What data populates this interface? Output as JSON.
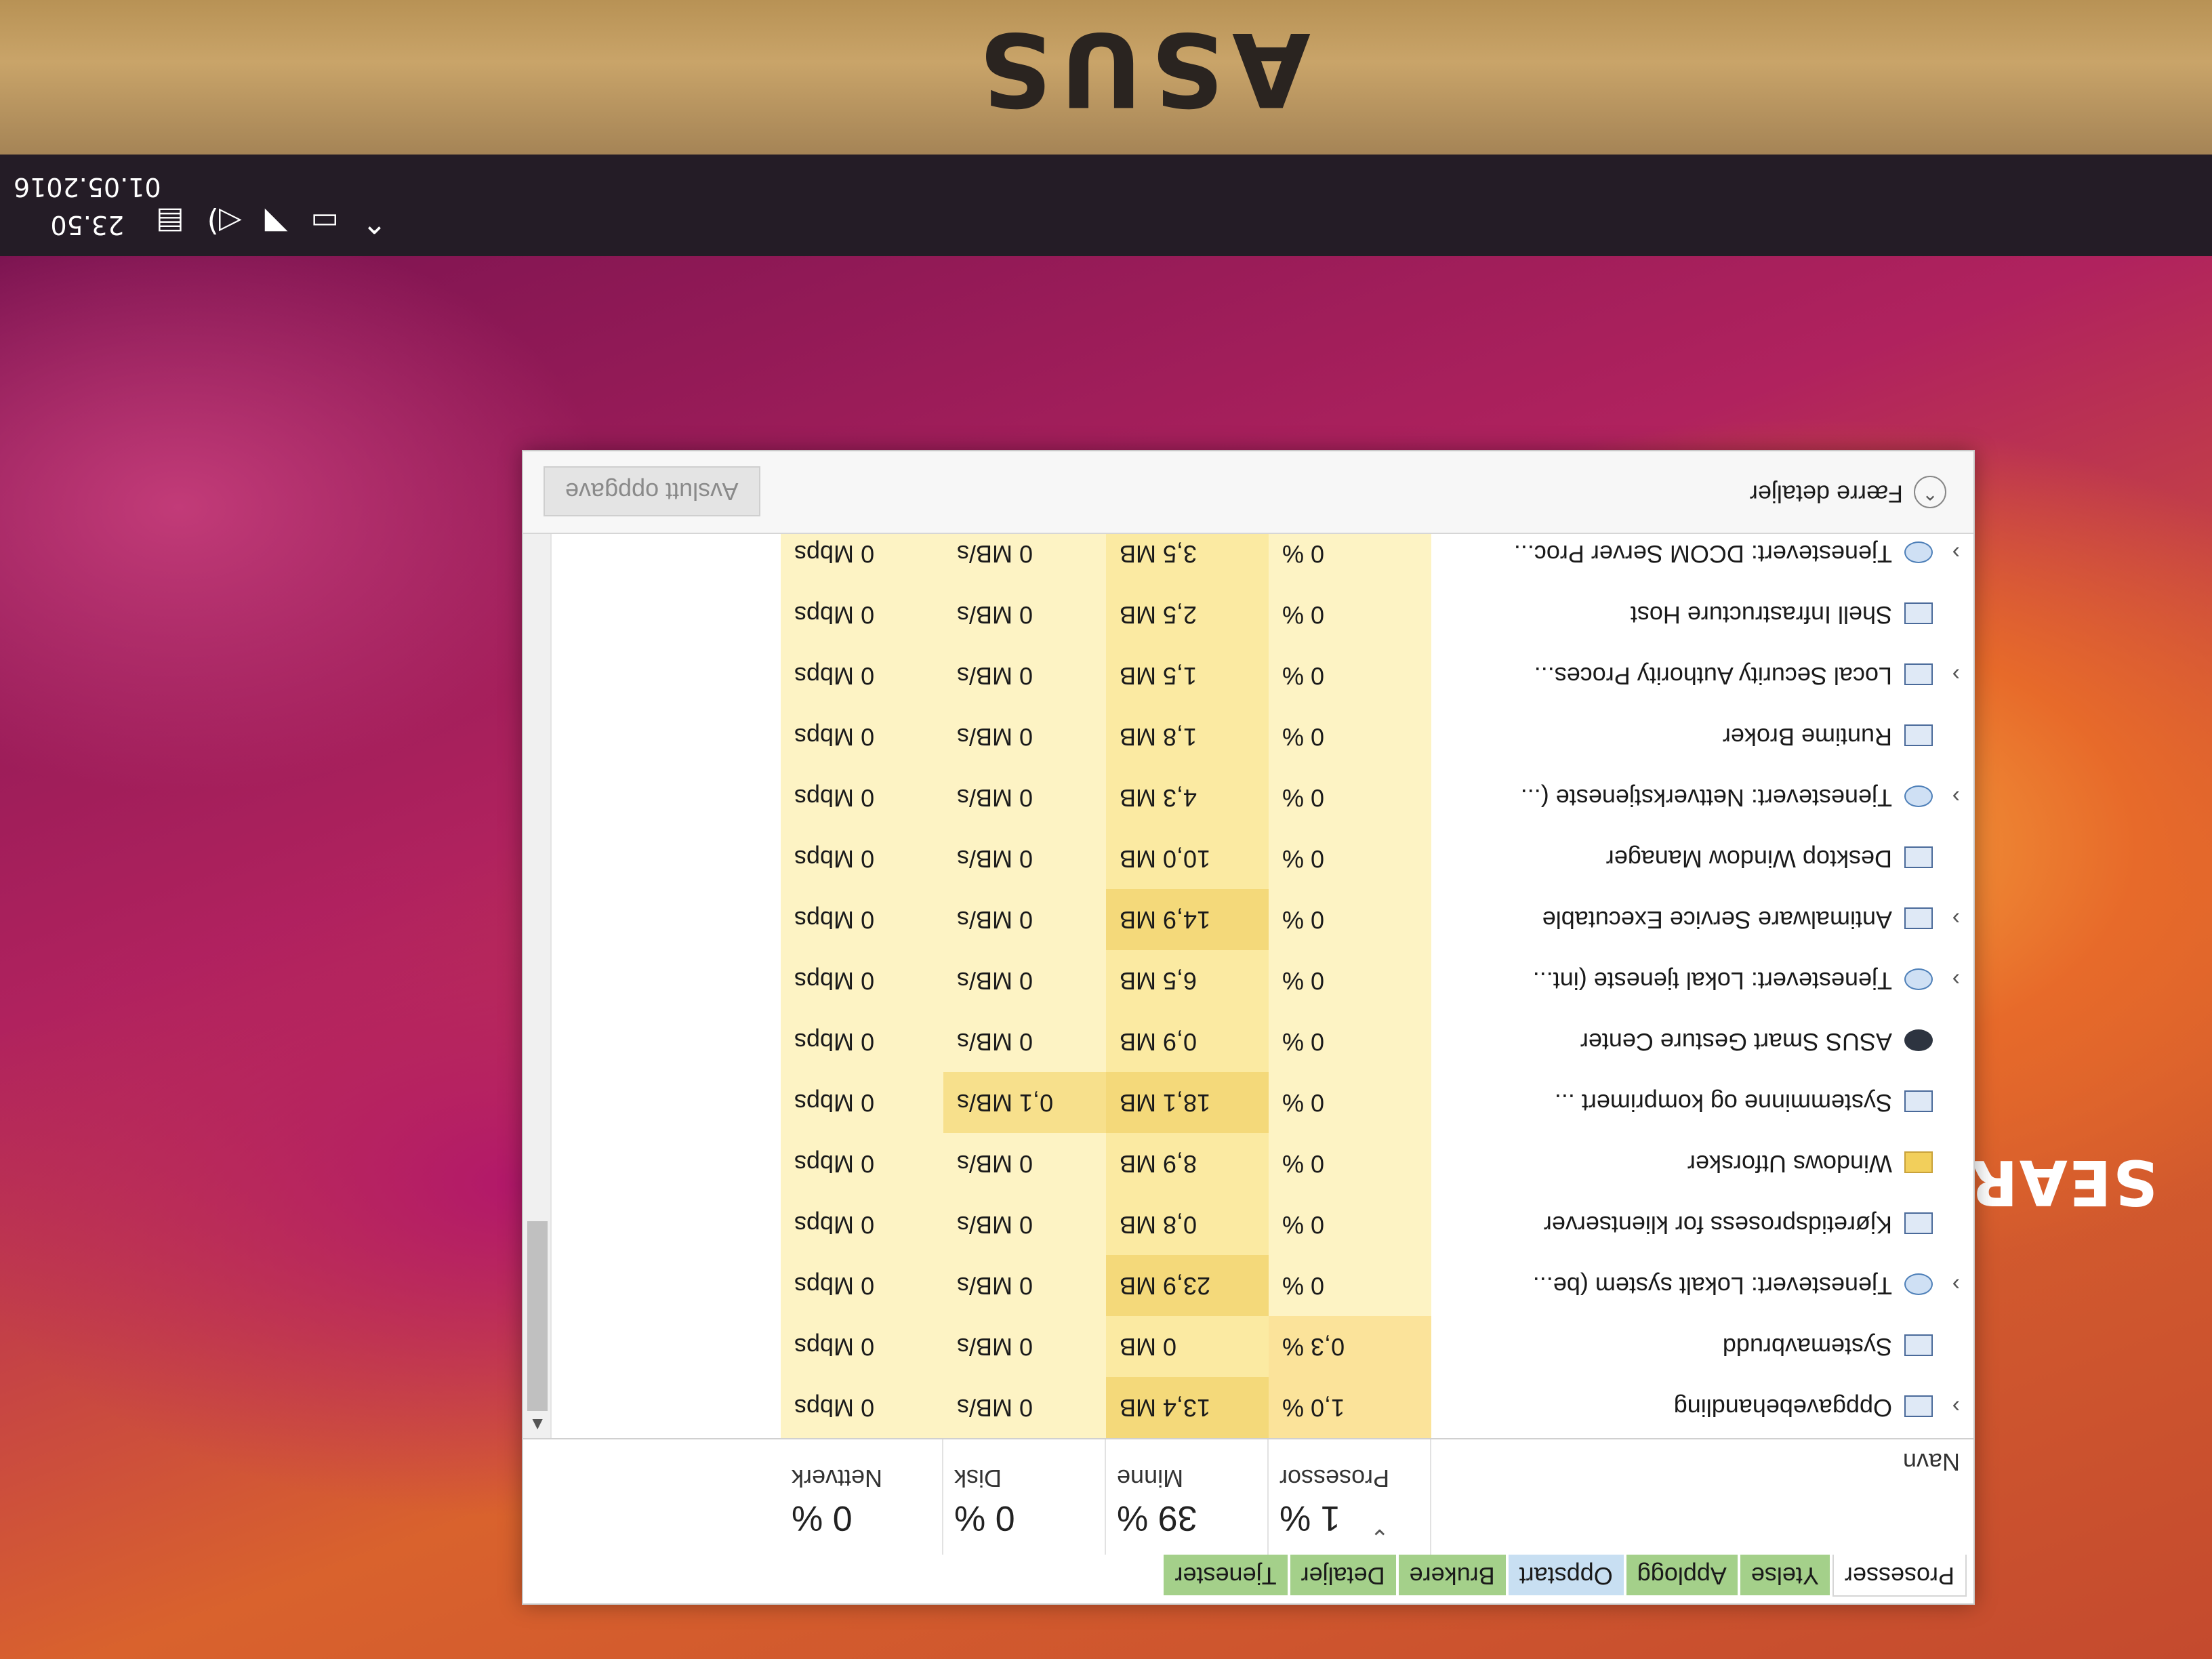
{
  "desktop": {
    "wallpaper_text": "SEARCH OF INCREDIBLE",
    "brand": "ASUS"
  },
  "taskbar": {
    "time": "23.50",
    "date": "01.05.2016",
    "icons": [
      "chevron-up-icon",
      "battery-icon",
      "wifi-icon",
      "volume-icon",
      "notifications-icon"
    ]
  },
  "task_manager": {
    "tabs": [
      {
        "label": "Prosesser"
      },
      {
        "label": "Ytelse"
      },
      {
        "label": "Applogg"
      },
      {
        "label": "Oppstart"
      },
      {
        "label": "Brukere"
      },
      {
        "label": "Detaljer"
      },
      {
        "label": "Tjenester"
      }
    ],
    "header": {
      "name_label": "Navn",
      "cpu": {
        "pct": "1 %",
        "label": "Prosessor"
      },
      "mem": {
        "pct": "39 %",
        "label": "Minne"
      },
      "disk": {
        "pct": "0 %",
        "label": "Disk"
      },
      "net": {
        "pct": "0 %",
        "label": "Nettverk"
      }
    },
    "rows": [
      {
        "name": "Oppgavebehandling",
        "expandable": true,
        "icon": "task-manager-icon",
        "cpu": "1,0 %",
        "mem": "13,4 MB",
        "disk": "0 MB/s",
        "net": "0 Mbps"
      },
      {
        "name": "Systemavbrudd",
        "expandable": false,
        "icon": "system-icon",
        "cpu": "0,3 %",
        "mem": "0 MB",
        "disk": "0 MB/s",
        "net": "0 Mbps"
      },
      {
        "name": "Tjenestevert: Lokalt system (be...",
        "expandable": true,
        "icon": "gear-icon",
        "cpu": "0 %",
        "mem": "23,9 MB",
        "disk": "0 MB/s",
        "net": "0 Mbps"
      },
      {
        "name": "Kjøretidsprosess for klientserver",
        "expandable": false,
        "icon": "system-icon",
        "cpu": "0 %",
        "mem": "0,8 MB",
        "disk": "0 MB/s",
        "net": "0 Mbps"
      },
      {
        "name": "Windows Utforsker",
        "expandable": false,
        "icon": "folder-icon",
        "cpu": "0 %",
        "mem": "8,9 MB",
        "disk": "0 MB/s",
        "net": "0 Mbps"
      },
      {
        "name": "Systemminne og komprimert ...",
        "expandable": false,
        "icon": "system-icon",
        "cpu": "0 %",
        "mem": "18,1 MB",
        "disk": "0,1 MB/s",
        "net": "0 Mbps"
      },
      {
        "name": "ASUS Smart Gesture Center",
        "expandable": false,
        "icon": "asus-icon",
        "cpu": "0 %",
        "mem": "0,9 MB",
        "disk": "0 MB/s",
        "net": "0 Mbps"
      },
      {
        "name": "Tjenestevert: Lokal tjeneste (int...",
        "expandable": true,
        "icon": "gear-icon",
        "cpu": "0 %",
        "mem": "6,5 MB",
        "disk": "0 MB/s",
        "net": "0 Mbps"
      },
      {
        "name": "Antimalware Service Executable",
        "expandable": true,
        "icon": "system-icon",
        "cpu": "0 %",
        "mem": "14,9 MB",
        "disk": "0 MB/s",
        "net": "0 Mbps"
      },
      {
        "name": "Desktop Window Manager",
        "expandable": false,
        "icon": "system-icon",
        "cpu": "0 %",
        "mem": "10,0 MB",
        "disk": "0 MB/s",
        "net": "0 Mbps"
      },
      {
        "name": "Tjenestevert: Nettverkstjeneste (...",
        "expandable": true,
        "icon": "gear-icon",
        "cpu": "0 %",
        "mem": "4,3 MB",
        "disk": "0 MB/s",
        "net": "0 Mbps"
      },
      {
        "name": "Runtime Broker",
        "expandable": false,
        "icon": "system-icon",
        "cpu": "0 %",
        "mem": "1,8 MB",
        "disk": "0 MB/s",
        "net": "0 Mbps"
      },
      {
        "name": "Local Security Authority Proces...",
        "expandable": true,
        "icon": "system-icon",
        "cpu": "0 %",
        "mem": "1,5 MB",
        "disk": "0 MB/s",
        "net": "0 Mbps"
      },
      {
        "name": "Shell Infrastructure Host",
        "expandable": false,
        "icon": "system-icon",
        "cpu": "0 %",
        "mem": "2,5 MB",
        "disk": "0 MB/s",
        "net": "0 Mbps"
      },
      {
        "name": "Tjenestevert: DCOM Server Proc...",
        "expandable": true,
        "icon": "gear-icon",
        "cpu": "0 %",
        "mem": "3,5 MB",
        "disk": "0 MB/s",
        "net": "0 Mbps"
      }
    ],
    "footer": {
      "fewer_details": "Færre detaljer",
      "end_task": "Avslutt oppgave"
    }
  },
  "colors": {
    "heat_light": "#fdf3c4",
    "heat_mid": "#fbeaa2",
    "heat_warm": "#f4d97a",
    "tab_highlight": "#a4d08a"
  }
}
